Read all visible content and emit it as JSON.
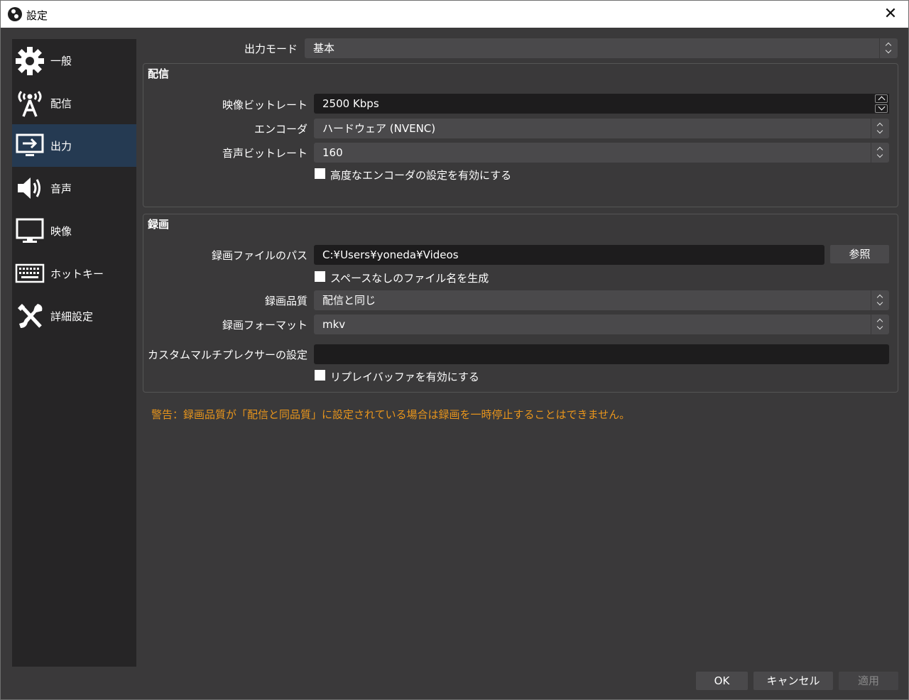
{
  "window": {
    "title": "設定",
    "close_glyph": "✕"
  },
  "sidebar": {
    "items": [
      {
        "label": "一般",
        "icon": "gear-icon"
      },
      {
        "label": "配信",
        "icon": "broadcast-icon"
      },
      {
        "label": "出力",
        "icon": "output-monitor-icon",
        "active": true
      },
      {
        "label": "音声",
        "icon": "speaker-icon"
      },
      {
        "label": "映像",
        "icon": "monitor-icon"
      },
      {
        "label": "ホットキー",
        "icon": "keyboard-icon"
      },
      {
        "label": "詳細設定",
        "icon": "tools-icon"
      }
    ]
  },
  "output_mode": {
    "label": "出力モード",
    "value": "基本"
  },
  "streaming": {
    "title": "配信",
    "video_bitrate": {
      "label": "映像ビットレート",
      "value": "2500 Kbps"
    },
    "encoder": {
      "label": "エンコーダ",
      "value": "ハードウェア (NVENC)"
    },
    "audio_bitrate": {
      "label": "音声ビットレート",
      "value": "160"
    },
    "advanced_checkbox": {
      "label": "高度なエンコーダの設定を有効にする",
      "checked": false
    }
  },
  "recording": {
    "title": "録画",
    "path": {
      "label": "録画ファイルのパス",
      "value": "C:¥Users¥yoneda¥Videos"
    },
    "browse_button": "参照",
    "no_space_checkbox": {
      "label": "スペースなしのファイル名を生成",
      "checked": false
    },
    "quality": {
      "label": "録画品質",
      "value": "配信と同じ"
    },
    "format": {
      "label": "録画フォーマット",
      "value": "mkv"
    },
    "muxer": {
      "label": "カスタムマルチプレクサーの設定",
      "value": ""
    },
    "replay_checkbox": {
      "label": "リプレイバッファを有効にする",
      "checked": false
    }
  },
  "warning": "警告：録画品質が「配信と同品質」に設定されている場合は録画を一時停止することはできません。",
  "footer": {
    "ok": "OK",
    "cancel": "キャンセル",
    "apply": "適用"
  },
  "colors": {
    "background": "#3a393a",
    "sidebar": "#262526",
    "active": "#253a52",
    "warning": "#e8951c"
  }
}
